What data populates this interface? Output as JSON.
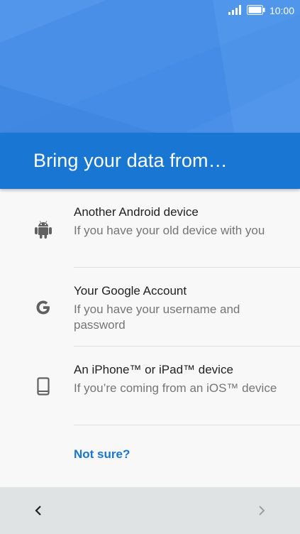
{
  "status": {
    "time": "10:00",
    "icons": [
      "signal-icon",
      "battery-icon"
    ]
  },
  "header": {
    "title": "Bring your data from…"
  },
  "options": [
    {
      "icon": "android-icon",
      "title": "Another Android device",
      "subtitle": "If you have your old device with you"
    },
    {
      "icon": "google-icon",
      "title": "Your Google Account",
      "subtitle": "If you have your username and password"
    },
    {
      "icon": "phone-icon",
      "title": "An iPhone™ or iPad™ device",
      "subtitle": "If you’re coming from an iOS™ device"
    }
  ],
  "links": {
    "not_sure": "Not sure?"
  },
  "nav": {
    "back_icon": "chevron-left-icon",
    "next_icon": "chevron-right-icon"
  },
  "colors": {
    "accent": "#1976d2",
    "hero": "#4a90e8",
    "nav_bar": "#e0e3e3"
  }
}
